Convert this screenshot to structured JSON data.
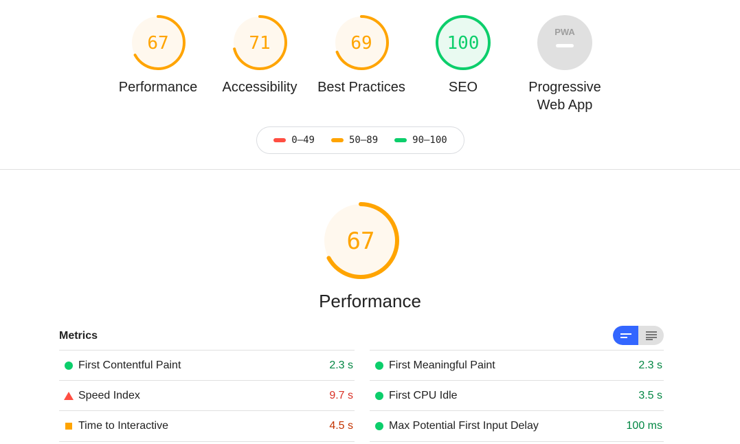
{
  "colors": {
    "fail": "#ff4e42",
    "average": "#ffa400",
    "pass": "#0cce6b",
    "pwa_gray": "#e0e0e0",
    "toggle_active": "#3366ff"
  },
  "categories": [
    {
      "label": "Performance",
      "score": "67",
      "score_fraction": 0.67,
      "rating": "average"
    },
    {
      "label": "Accessibility",
      "score": "71",
      "score_fraction": 0.71,
      "rating": "average"
    },
    {
      "label": "Best Practices",
      "score": "69",
      "score_fraction": 0.69,
      "rating": "average"
    },
    {
      "label": "SEO",
      "score": "100",
      "score_fraction": 1.0,
      "rating": "pass"
    },
    {
      "label_line1": "Progressive",
      "label_line2": "Web App",
      "badge": "PWA",
      "rating": "na"
    }
  ],
  "legend": [
    {
      "range": "0–49",
      "color": "#ff4e42"
    },
    {
      "range": "50–89",
      "color": "#ffa400"
    },
    {
      "range": "90–100",
      "color": "#0cce6b"
    }
  ],
  "section": {
    "score": "67",
    "score_fraction": 0.67,
    "title": "Performance"
  },
  "metrics": {
    "header": "Metrics",
    "left": [
      {
        "name": "First Contentful Paint",
        "value": "2.3 s",
        "rating": "pass",
        "icon": "green-circle-icon"
      },
      {
        "name": "Speed Index",
        "value": "9.7 s",
        "rating": "fail",
        "icon": "red-triangle-icon"
      },
      {
        "name": "Time to Interactive",
        "value": "4.5 s",
        "rating": "average",
        "icon": "orange-square-icon"
      }
    ],
    "right": [
      {
        "name": "First Meaningful Paint",
        "value": "2.3 s",
        "rating": "pass",
        "icon": "green-circle-icon"
      },
      {
        "name": "First CPU Idle",
        "value": "3.5 s",
        "rating": "pass",
        "icon": "green-circle-icon"
      },
      {
        "name": "Max Potential First Input Delay",
        "value": "100 ms",
        "rating": "pass",
        "icon": "green-circle-icon"
      }
    ]
  }
}
